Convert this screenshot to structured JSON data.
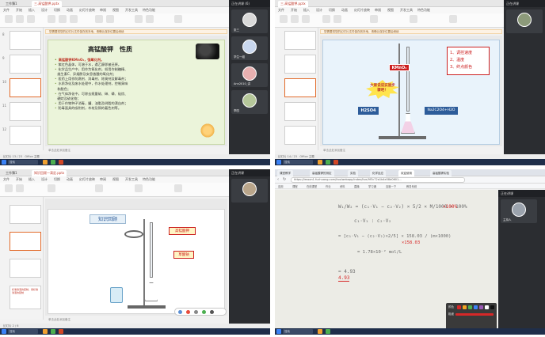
{
  "q1": {
    "tabs": [
      "工作簿1",
      "三.高锰酸钾.pptx"
    ],
    "ribbon_tabs": [
      "文件",
      "开始",
      "插入",
      "设计",
      "切换",
      "动画",
      "幻灯片放映",
      "审阅",
      "视图",
      "开发工具",
      "特色功能"
    ],
    "notice": "您需要将您的幻灯片文件保存到本地，请确认保存位置后继续",
    "slide_numbers": [
      "8",
      "9",
      "10",
      "11",
      "12"
    ],
    "slide": {
      "title": "高锰酸钾　性质",
      "bullets": [
        "高锰酸钾KMnO₄，强氧化剂。",
        "紫红色晶体，可溶于水，遇乙醇即被还原。",
        "化学品生产中，用作为氧化剂，如用作制糖精、",
        "维生素C、异烟肼及安息香酸的氧化剂；",
        "医药上用作防腐剂、消毒剂、除臭剂及解毒剂；",
        "水质净化及废水处理中，作水处理剂，控制臭味",
        "和脱色；",
        "在气体净化中，可除去痕量硫、砷、磷、硅烷、",
        "硼烷及硫化物；",
        "用于作物种子消毒，罐、油脂及树脂的漂白剂；",
        "防毒面具的吸附剂，木材及铜的着色剂等。"
      ]
    },
    "notes": "单击此处添加备注",
    "status": "幻灯片 13 / 23　Office 主题",
    "search": "搜索",
    "video": {
      "title": "正在讲课 (6)",
      "participants": [
        "张三",
        "学生一组",
        "Ann2010_讲",
        "李四"
      ]
    }
  },
  "q2": {
    "tabs": [
      "三.高锰酸钾.pptx"
    ],
    "ribbon_tabs": [
      "文件",
      "开始",
      "插入",
      "设计",
      "切换",
      "动画",
      "幻灯片放映",
      "审阅",
      "视图",
      "开发工具",
      "特色功能"
    ],
    "notice": "您需要将您的幻灯片文件保存到本地，请确认保存位置后继续",
    "slide": {
      "kmno4": "KMnO₄",
      "burst": "大家说说实验步骤吧！",
      "reagent_a": "H2SO4",
      "reagent_b": "Na2C2O4+H2O",
      "steps": [
        "1、调控速度",
        "2、温度",
        "3、终点颜色"
      ]
    },
    "notes": "单击此处添加备注",
    "status": "幻灯片 14 / 23　Office 主题",
    "search": "搜索",
    "video": {
      "title": "正在讲课"
    }
  },
  "q3": {
    "tabs": [
      "工作簿1",
      "知识回顾—滴定.pptx"
    ],
    "ribbon_tabs": [
      "文件",
      "开始",
      "插入",
      "设计",
      "切换",
      "动画",
      "幻灯片放映",
      "审阅",
      "视图",
      "开发工具",
      "特色功能"
    ],
    "slide": {
      "title": "知识回顾",
      "label1": "高锰酸钾",
      "label2": "草酸钠"
    },
    "thumb_text": "标准溶液的配制，用标准溶液的配制",
    "notes": "单击此处添加备注",
    "status": "幻灯片 2 / 6",
    "search": "搜索",
    "video": {
      "title": "正在讲课"
    }
  },
  "q4": {
    "tabs": [
      "课堂教学",
      "高锰酸钾的测定",
      "实验",
      "化学反应",
      "欢迎使用",
      "高锰酸钾实验"
    ],
    "url": "https://lesson1.fuchuang.com/live/webapp/index/live/9f3c72a1b4e58d0601...",
    "bookmarks": [
      "应用",
      "课程",
      "在线课堂",
      "作业",
      "资料",
      "直播",
      "学习通",
      "百度一下",
      "教务系统"
    ],
    "board": {
      "line1": "W₁/W₂ = (c₁·V₁ − c₂·V₂) × 5/2 × M/1000 × 100%",
      "line2": "c₁·V₁ : c₂·V₂",
      "line3": "= [c₁·V₁ − (c₂·V₂)×2/5] × 158.03 / (m×1000)",
      "line4": "= 1.78×10⁻² mol/L",
      "line5": "= 4.93",
      "red1": "×100%",
      "red2": "×158.03",
      "red3": "4.93"
    },
    "palette": {
      "color_label": "颜色",
      "size_label": "粗细",
      "finish": "完成"
    },
    "video": {
      "title": "正在讲课",
      "name": "主持人"
    },
    "search": "搜索"
  }
}
